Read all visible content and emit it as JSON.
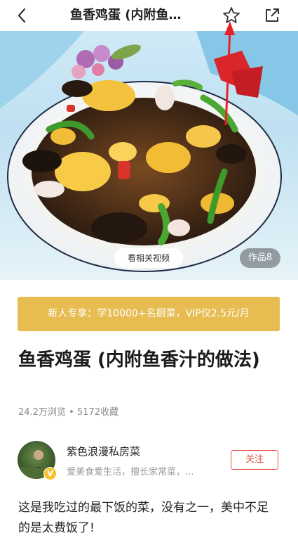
{
  "nav": {
    "title": "鱼香鸡蛋 (内附鱼…",
    "back_icon": "chevron-left-icon",
    "favorite_icon": "star-icon",
    "share_icon": "share-external-icon"
  },
  "hero": {
    "video_label": "看相关视频",
    "works_label": "作品8"
  },
  "promo": {
    "text": "新人专享：学10000+名厨菜，VIP仅2.5元/月"
  },
  "recipe": {
    "title": "鱼香鸡蛋 (内附鱼香汁的做法)",
    "stats": "24.2万浏览 • 5172收藏"
  },
  "author": {
    "name": "紫色浪漫私房菜",
    "bio": "爱美食爱生活，擅长家常菜，...",
    "badge": "V",
    "follow_label": "关注"
  },
  "description": "这是我吃过的最下饭的菜，没有之一，美中不足的是太费饭了!",
  "colors": {
    "promo_bg": "#e7bd52",
    "follow_red": "#e4573f",
    "annotation_red": "#e8202a"
  }
}
